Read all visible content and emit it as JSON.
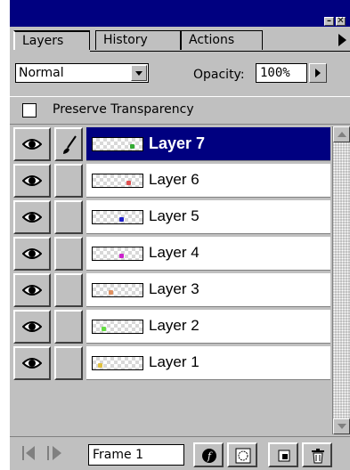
{
  "tabs": [
    {
      "label": "Layers",
      "active": true
    },
    {
      "label": "History",
      "active": false
    },
    {
      "label": "Actions",
      "active": false
    }
  ],
  "blend_mode": "Normal",
  "opacity": {
    "label": "Opacity:",
    "value": "100%"
  },
  "preserve_transparency": {
    "label": "Preserve Transparency",
    "checked": false
  },
  "layers": [
    {
      "name": "Layer 7",
      "selected": true,
      "visible": true,
      "thumb_color": "#33aa33"
    },
    {
      "name": "Layer 6",
      "selected": false,
      "visible": true,
      "thumb_color": "#e05050"
    },
    {
      "name": "Layer 5",
      "selected": false,
      "visible": true,
      "thumb_color": "#2020cc"
    },
    {
      "name": "Layer 4",
      "selected": false,
      "visible": true,
      "thumb_color": "#cc22cc"
    },
    {
      "name": "Layer 3",
      "selected": false,
      "visible": true,
      "thumb_color": "#e09060"
    },
    {
      "name": "Layer 2",
      "selected": false,
      "visible": true,
      "thumb_color": "#66dd44"
    },
    {
      "name": "Layer 1",
      "selected": false,
      "visible": true,
      "thumb_color": "#e0c040"
    }
  ],
  "frame": {
    "label": "Frame 1"
  },
  "colors": {
    "title_bar": "#000080",
    "panel": "#c0c0c0",
    "selection": "#000080"
  }
}
